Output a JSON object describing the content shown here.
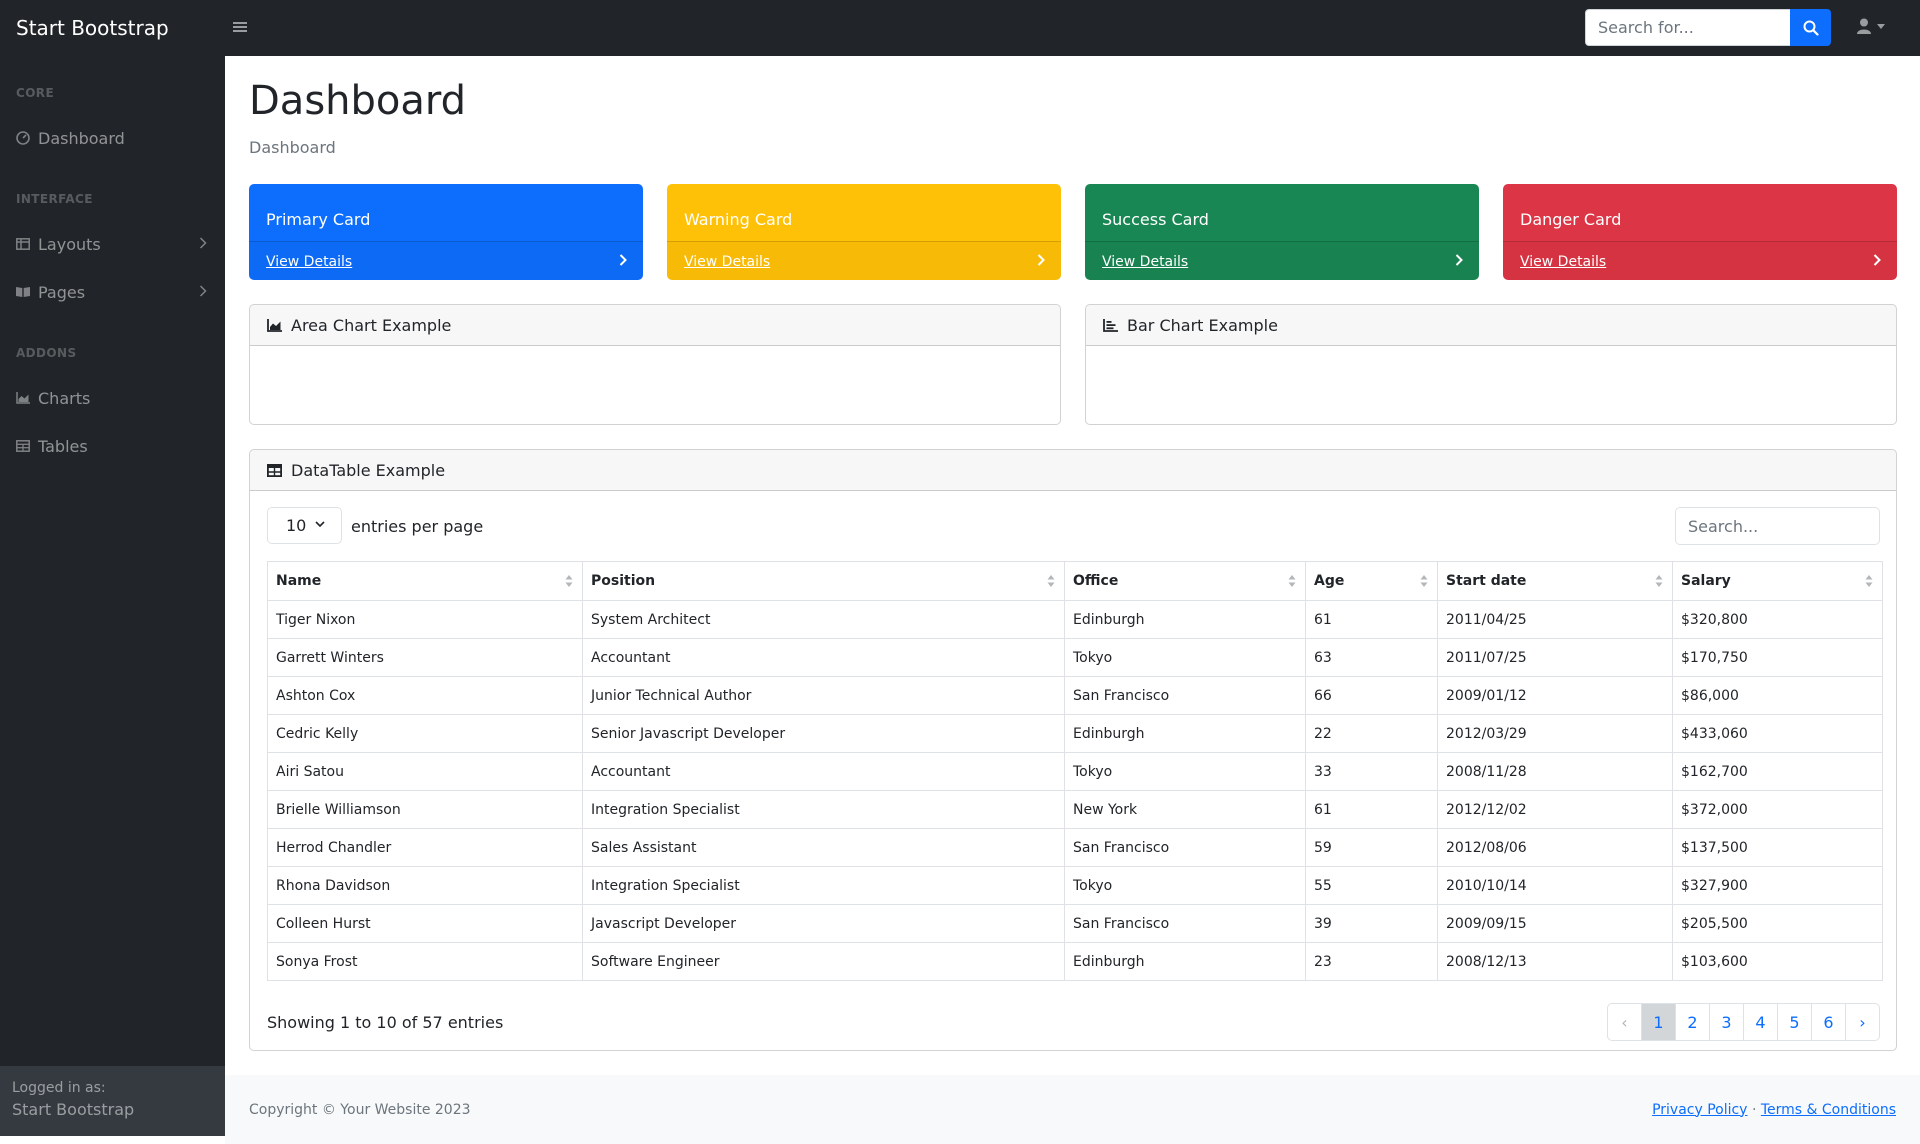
{
  "topbar": {
    "brand": "Start Bootstrap",
    "search_placeholder": "Search for..."
  },
  "sidebar": {
    "sections": [
      {
        "heading": "CORE",
        "items": [
          {
            "label": "Dashboard",
            "icon": "dashboard-icon"
          }
        ]
      },
      {
        "heading": "INTERFACE",
        "items": [
          {
            "label": "Layouts",
            "icon": "columns-icon"
          },
          {
            "label": "Pages",
            "icon": "book-open-icon"
          }
        ]
      },
      {
        "heading": "ADDONS",
        "items": [
          {
            "label": "Charts",
            "icon": "area-chart-icon"
          },
          {
            "label": "Tables",
            "icon": "table-icon"
          }
        ]
      }
    ],
    "footer": {
      "label": "Logged in as:",
      "name": "Start Bootstrap"
    }
  },
  "page": {
    "title": "Dashboard",
    "breadcrumb": "Dashboard"
  },
  "cards": [
    {
      "title": "Primary Card",
      "link": "View Details",
      "color": "#0d6efd"
    },
    {
      "title": "Warning Card",
      "link": "View Details",
      "color": "#ffc107"
    },
    {
      "title": "Success Card",
      "link": "View Details",
      "color": "#198754"
    },
    {
      "title": "Danger Card",
      "link": "View Details",
      "color": "#dc3545"
    }
  ],
  "charts": {
    "area_title": "Area Chart Example",
    "bar_title": "Bar Chart Example"
  },
  "datatable": {
    "title": "DataTable Example",
    "per_page": "10",
    "per_page_label": "entries per page",
    "search_placeholder": "Search...",
    "columns": [
      "Name",
      "Position",
      "Office",
      "Age",
      "Start date",
      "Salary"
    ],
    "rows": [
      [
        "Tiger Nixon",
        "System Architect",
        "Edinburgh",
        "61",
        "2011/04/25",
        "$320,800"
      ],
      [
        "Garrett Winters",
        "Accountant",
        "Tokyo",
        "63",
        "2011/07/25",
        "$170,750"
      ],
      [
        "Ashton Cox",
        "Junior Technical Author",
        "San Francisco",
        "66",
        "2009/01/12",
        "$86,000"
      ],
      [
        "Cedric Kelly",
        "Senior Javascript Developer",
        "Edinburgh",
        "22",
        "2012/03/29",
        "$433,060"
      ],
      [
        "Airi Satou",
        "Accountant",
        "Tokyo",
        "33",
        "2008/11/28",
        "$162,700"
      ],
      [
        "Brielle Williamson",
        "Integration Specialist",
        "New York",
        "61",
        "2012/12/02",
        "$372,000"
      ],
      [
        "Herrod Chandler",
        "Sales Assistant",
        "San Francisco",
        "59",
        "2012/08/06",
        "$137,500"
      ],
      [
        "Rhona Davidson",
        "Integration Specialist",
        "Tokyo",
        "55",
        "2010/10/14",
        "$327,900"
      ],
      [
        "Colleen Hurst",
        "Javascript Developer",
        "San Francisco",
        "39",
        "2009/09/15",
        "$205,500"
      ],
      [
        "Sonya Frost",
        "Software Engineer",
        "Edinburgh",
        "23",
        "2008/12/13",
        "$103,600"
      ]
    ],
    "info": "Showing 1 to 10 of 57 entries",
    "pages": [
      "‹",
      "1",
      "2",
      "3",
      "4",
      "5",
      "6",
      "›"
    ],
    "active_page": "1"
  },
  "footer": {
    "copyright": "Copyright © Your Website 2023",
    "privacy": "Privacy Policy",
    "separator": "·",
    "terms": "Terms & Conditions"
  }
}
